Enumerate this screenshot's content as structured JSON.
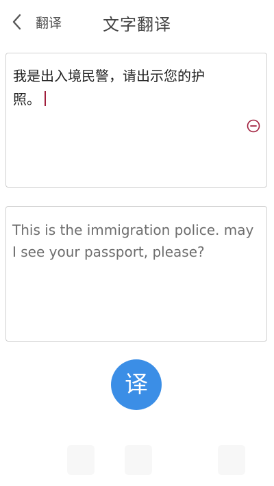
{
  "header": {
    "back_label": "翻译",
    "title": "文字翻译"
  },
  "source": {
    "text": "我是出入境民警，请出示您的护照。"
  },
  "target": {
    "text": "This is the immigration police. may I see your passport, please?"
  },
  "actions": {
    "translate_label": "译"
  },
  "colors": {
    "accent": "#3b8ee6",
    "caret": "#a01e3c",
    "clear_icon": "#a01e3c",
    "panel_border": "#cfcfcf"
  },
  "icons": {
    "back": "chevron-left-icon",
    "clear": "minus-circle-icon"
  }
}
